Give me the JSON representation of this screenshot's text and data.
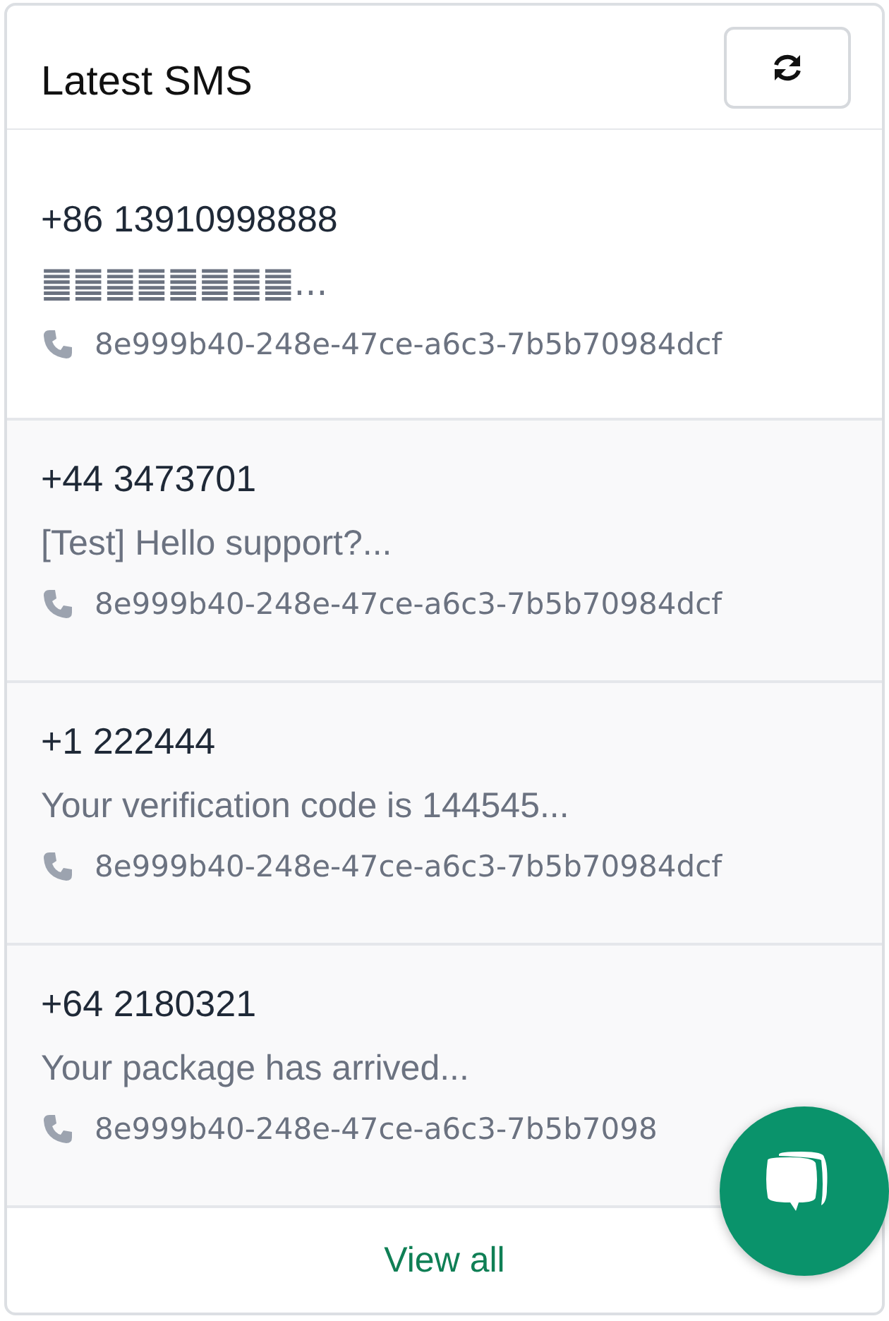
{
  "card": {
    "title": "Latest SMS"
  },
  "messages": [
    {
      "number": "+86 13910998888",
      "text": "䷀䷀䷀䷀䷀䷀䷀䷀...",
      "device": "8e999b40-248e-47ce-a6c3-7b5b70984dcf",
      "read": false
    },
    {
      "number": "+44 3473701",
      "text": "[Test] Hello support?...",
      "device": "8e999b40-248e-47ce-a6c3-7b5b70984dcf",
      "read": true
    },
    {
      "number": "+1 222444",
      "text": "Your verification code is 144545...",
      "device": "8e999b40-248e-47ce-a6c3-7b5b70984dcf",
      "read": true
    },
    {
      "number": "+64 2180321",
      "text": "Your package has arrived...",
      "device": "8e999b40-248e-47ce-a6c3-7b5b7098",
      "read": true
    }
  ],
  "footer": {
    "link": "View all"
  }
}
